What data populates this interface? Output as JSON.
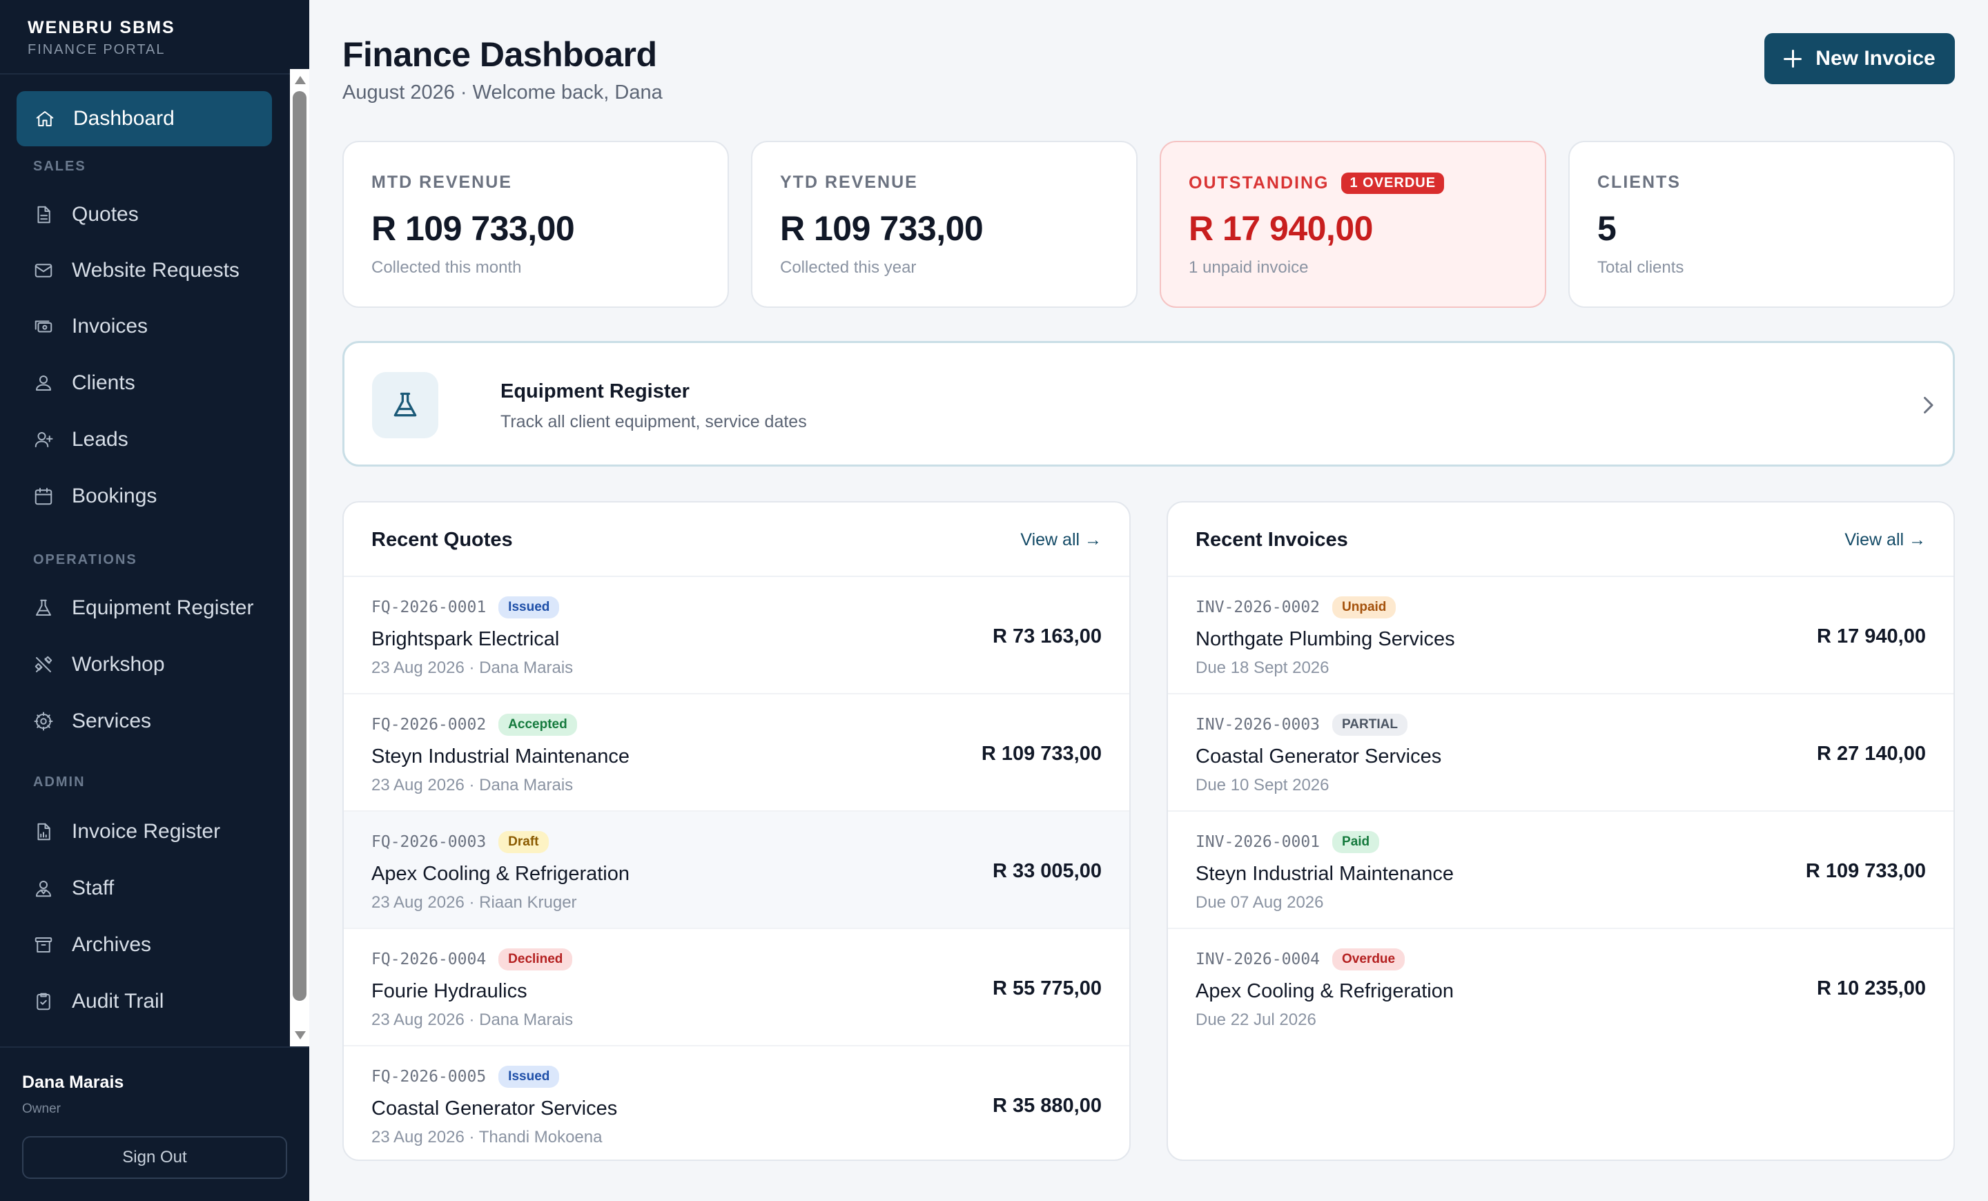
{
  "sidebar": {
    "brand": "WENBRU SBMS",
    "brand_sub": "FINANCE PORTAL",
    "active": {
      "label": "Dashboard",
      "icon": "home-icon"
    },
    "sections": [
      "SALES",
      "OPERATIONS",
      "ADMIN"
    ],
    "items": [
      {
        "label": "Quotes",
        "icon": "document-icon"
      },
      {
        "label": "Website Requests",
        "icon": "mail-icon"
      },
      {
        "label": "Invoices",
        "icon": "cash-icon"
      },
      {
        "label": "Clients",
        "icon": "user-icon"
      },
      {
        "label": "Leads",
        "icon": "user-plus-icon"
      },
      {
        "label": "Bookings",
        "icon": "calendar-icon"
      },
      {
        "label": "Equipment Register",
        "icon": "flask-icon"
      },
      {
        "label": "Workshop",
        "icon": "tools-icon"
      },
      {
        "label": "Services",
        "icon": "gear-icon"
      },
      {
        "label": "Invoice Register",
        "icon": "report-icon"
      },
      {
        "label": "Staff",
        "icon": "users-icon"
      },
      {
        "label": "Archives",
        "icon": "archive-icon"
      },
      {
        "label": "Audit Trail",
        "icon": "clipboard-check-icon"
      }
    ],
    "user": {
      "name": "Dana Marais",
      "role": "Owner",
      "signout": "Sign Out"
    }
  },
  "header": {
    "title": "Finance Dashboard",
    "subtitle": "August 2026 · Welcome back, Dana",
    "new_invoice": "New Invoice"
  },
  "kpis": [
    {
      "label": "MTD REVENUE",
      "value": "R 109 733,00",
      "note": "Collected this month"
    },
    {
      "label": "YTD REVENUE",
      "value": "R 109 733,00",
      "note": "Collected this year"
    },
    {
      "label": "OUTSTANDING",
      "badge": "1 OVERDUE",
      "value": "R 17 940,00",
      "note": "1 unpaid invoice"
    },
    {
      "label": "CLIENTS",
      "value": "5",
      "note": "Total clients"
    }
  ],
  "equipment": {
    "title": "Equipment Register",
    "desc": "Track all client equipment, service dates"
  },
  "quotes": {
    "title": "Recent Quotes",
    "view_all": "View all →",
    "rows": [
      {
        "id": "FQ-2026-0001",
        "status": "Issued",
        "name": "Brightspark Electrical",
        "meta": "23 Aug 2026 · Dana Marais",
        "amount": "R 73 163,00"
      },
      {
        "id": "FQ-2026-0002",
        "status": "Accepted",
        "name": "Steyn Industrial Maintenance",
        "meta": "23 Aug 2026 · Dana Marais",
        "amount": "R 109 733,00"
      },
      {
        "id": "FQ-2026-0003",
        "status": "Draft",
        "name": "Apex Cooling & Refrigeration",
        "meta": "23 Aug 2026 · Riaan Kruger",
        "amount": "R 33 005,00"
      },
      {
        "id": "FQ-2026-0004",
        "status": "Declined",
        "name": "Fourie Hydraulics",
        "meta": "23 Aug 2026 · Dana Marais",
        "amount": "R 55 775,00"
      },
      {
        "id": "FQ-2026-0005",
        "status": "Issued",
        "name": "Coastal Generator Services",
        "meta": "23 Aug 2026 · Thandi Mokoena",
        "amount": "R 35 880,00"
      }
    ]
  },
  "invoices": {
    "title": "Recent Invoices",
    "view_all": "View all →",
    "rows": [
      {
        "id": "INV-2026-0002",
        "status": "Unpaid",
        "name": "Northgate Plumbing Services",
        "meta": "Due 18 Sept 2026",
        "amount": "R 17 940,00"
      },
      {
        "id": "INV-2026-0003",
        "status": "PARTIAL",
        "name": "Coastal Generator Services",
        "meta": "Due 10 Sept 2026",
        "amount": "R 27 140,00"
      },
      {
        "id": "INV-2026-0001",
        "status": "Paid",
        "name": "Steyn Industrial Maintenance",
        "meta": "Due 07 Aug 2026",
        "amount": "R 109 733,00"
      },
      {
        "id": "INV-2026-0004",
        "status": "Overdue",
        "name": "Apex Cooling & Refrigeration",
        "meta": "Due 22 Jul 2026",
        "amount": "R 10 235,00"
      }
    ]
  }
}
